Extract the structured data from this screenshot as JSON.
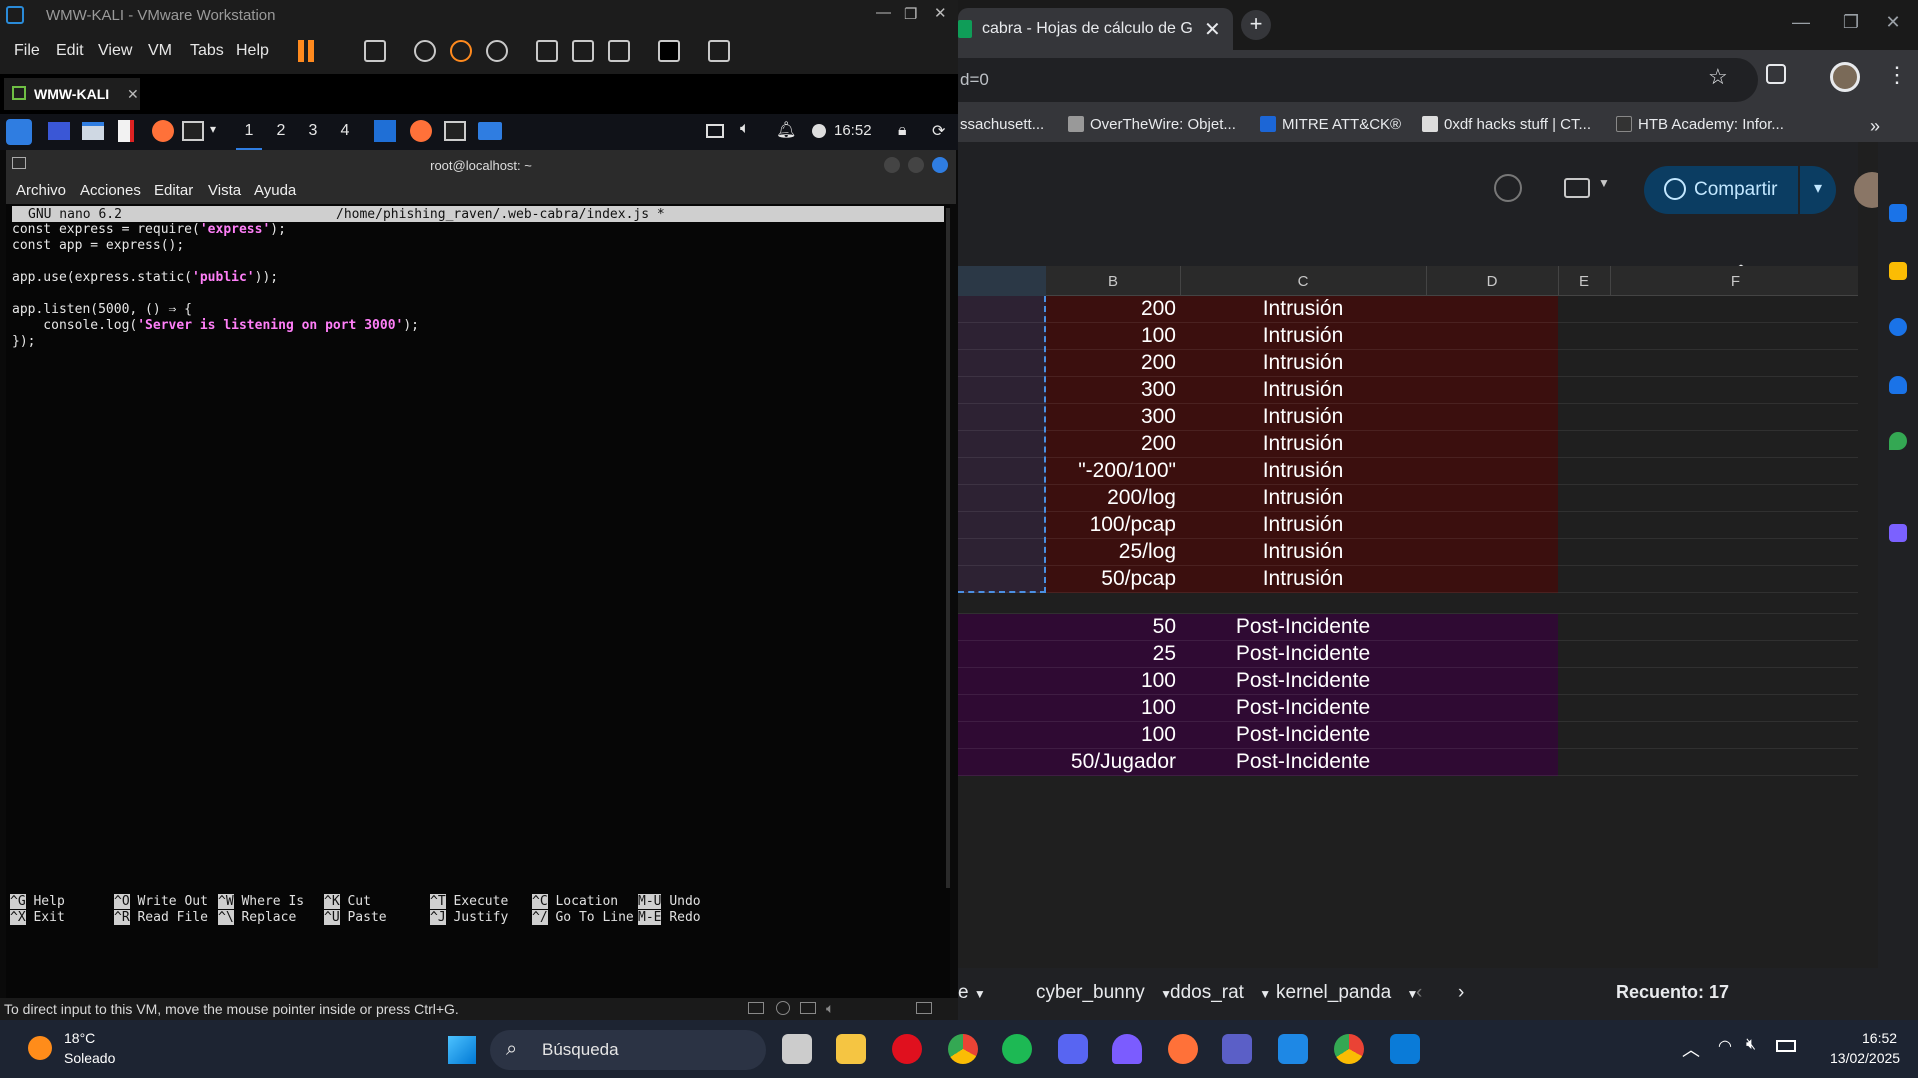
{
  "vmware": {
    "title": "WMW-KALI - VMware Workstation",
    "menu": [
      "File",
      "Edit",
      "View",
      "VM",
      "Tabs",
      "Help"
    ],
    "tab": "WMW-KALI",
    "status": "To direct input to this VM, move the mouse pointer inside or press Ctrl+G."
  },
  "kali": {
    "workspaces": [
      "1",
      "2",
      "3",
      "4"
    ],
    "clock": "16:52",
    "terminal_title": "root@localhost: ~",
    "terminal_menu": [
      "Archivo",
      "Acciones",
      "Editar",
      "Vista",
      "Ayuda"
    ],
    "nano_version": "GNU nano 6.2",
    "nano_file": "/home/phishing_raven/.web-cabra/index.js *",
    "code": [
      {
        "pre": "const express = require(",
        "str": "'express'",
        "post": ");"
      },
      {
        "pre": "const app = express();",
        "str": "",
        "post": ""
      },
      {
        "pre": "",
        "str": "",
        "post": ""
      },
      {
        "pre": "app.use(express.static(",
        "str": "'public'",
        "post": "));"
      },
      {
        "pre": "",
        "str": "",
        "post": ""
      },
      {
        "pre": "app.listen(5000, () ⇒ {",
        "str": "",
        "post": ""
      },
      {
        "pre": "    console.log(",
        "str": "'Server is listening on port 3000'",
        "post": ");"
      },
      {
        "pre": "});",
        "str": "",
        "post": ""
      }
    ],
    "help": [
      {
        "k1": "^G",
        "l1": "Help",
        "k2": "^X",
        "l2": "Exit"
      },
      {
        "k1": "^O",
        "l1": "Write Out",
        "k2": "^R",
        "l2": "Read File"
      },
      {
        "k1": "^W",
        "l1": "Where Is",
        "k2": "^\\",
        "l2": "Replace"
      },
      {
        "k1": "^K",
        "l1": "Cut",
        "k2": "^U",
        "l2": "Paste"
      },
      {
        "k1": "^T",
        "l1": "Execute",
        "k2": "^J",
        "l2": "Justify"
      },
      {
        "k1": "^C",
        "l1": "Location",
        "k2": "^/",
        "l2": "Go To Line"
      },
      {
        "k1": "M-U",
        "l1": "Undo",
        "k2": "M-E",
        "l2": "Redo"
      }
    ]
  },
  "chrome": {
    "tab_title": "cabra - Hojas de cálculo de Goo",
    "url_fragment": "d=0",
    "bookmarks": [
      "ssachusett...",
      "OverTheWire: Objet...",
      "MITRE ATT&CK®",
      "0xdf hacks stuff | CT...",
      "HTB Academy: Infor..."
    ],
    "share_label": "Compartir"
  },
  "sheet": {
    "columns": [
      "B",
      "C",
      "D",
      "E",
      "F"
    ],
    "rows": [
      {
        "b": "200",
        "c": "Intrusión",
        "group": "red"
      },
      {
        "b": "100",
        "c": "Intrusión",
        "group": "red"
      },
      {
        "b": "200",
        "c": "Intrusión",
        "group": "red"
      },
      {
        "b": "300",
        "c": "Intrusión",
        "group": "red"
      },
      {
        "b": "300",
        "c": "Intrusión",
        "group": "red"
      },
      {
        "b": "200",
        "c": "Intrusión",
        "group": "red"
      },
      {
        "b": "\"-200/100\"",
        "c": "Intrusión",
        "group": "red"
      },
      {
        "b": "200/log",
        "c": "Intrusión",
        "group": "red"
      },
      {
        "b": "100/pcap",
        "c": "Intrusión",
        "group": "red"
      },
      {
        "b": "25/log",
        "c": "Intrusión",
        "group": "red"
      },
      {
        "b": "50/pcap",
        "c": "Intrusión",
        "group": "red"
      },
      {
        "b": "",
        "c": "",
        "group": "empty"
      },
      {
        "b": "50",
        "c": "Post-Incidente",
        "group": "purple"
      },
      {
        "b": "25",
        "c": "Post-Incidente",
        "group": "purple"
      },
      {
        "b": "100",
        "c": "Post-Incidente",
        "group": "purple"
      },
      {
        "b": "100",
        "c": "Post-Incidente",
        "group": "purple"
      },
      {
        "b": "100",
        "c": "Post-Incidente",
        "group": "purple"
      },
      {
        "b": "50/Jugador",
        "c": "Post-Incidente",
        "group": "purple"
      }
    ],
    "tabs": [
      "e",
      "cyber_bunny",
      "ddos_rat",
      "kernel_panda"
    ],
    "count_label": "Recuento: 17",
    "colors": {
      "red": "#3b0f0e",
      "purple": "#2f0a33",
      "selected": "#2d2233"
    }
  },
  "taskbar": {
    "temp": "18°C",
    "weather": "Soleado",
    "search": "Búsqueda",
    "time": "16:52",
    "date": "13/02/2025"
  }
}
